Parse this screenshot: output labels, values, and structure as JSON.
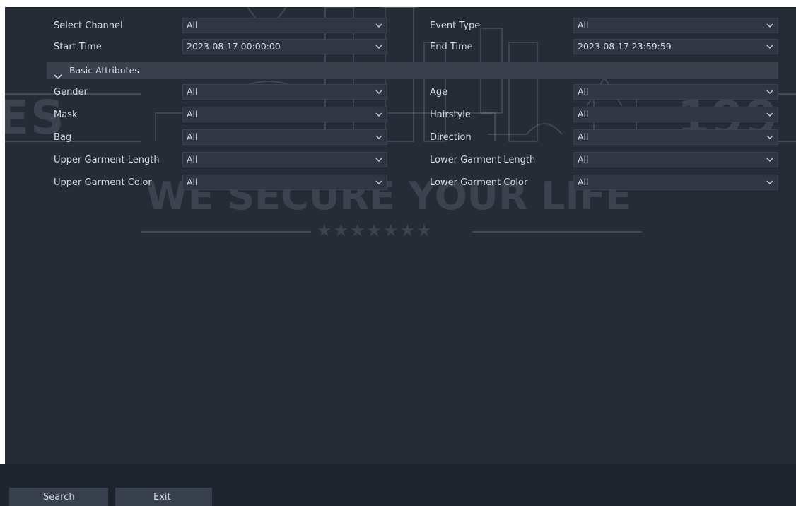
{
  "watermark": {
    "left_text": "ES",
    "right_text": "199",
    "slogan": "WE SECURE YOUR LIFE",
    "stars": "★★★★★★★"
  },
  "filters": {
    "select_channel": {
      "label": "Select Channel",
      "value": "All"
    },
    "event_type": {
      "label": "Event Type",
      "value": "All"
    },
    "start_time": {
      "label": "Start Time",
      "value": "2023-08-17 00:00:00"
    },
    "end_time": {
      "label": "End Time",
      "value": "2023-08-17 23:59:59"
    }
  },
  "section": {
    "label": "Basic Attributes"
  },
  "attributes": {
    "gender": {
      "label": "Gender",
      "value": "All"
    },
    "age": {
      "label": "Age",
      "value": "All"
    },
    "mask": {
      "label": "Mask",
      "value": "All"
    },
    "hairstyle": {
      "label": "Hairstyle",
      "value": "All"
    },
    "bag": {
      "label": "Bag",
      "value": "All"
    },
    "direction": {
      "label": "Direction",
      "value": "All"
    },
    "upper_garment_length": {
      "label": "Upper Garment Length",
      "value": "All"
    },
    "lower_garment_length": {
      "label": "Lower Garment Length",
      "value": "All"
    },
    "upper_garment_color": {
      "label": "Upper Garment Color",
      "value": "All"
    },
    "lower_garment_color": {
      "label": "Lower Garment Color",
      "value": "All"
    }
  },
  "footer": {
    "search_label": "Search",
    "exit_label": "Exit"
  },
  "colors": {
    "background": "#262b36",
    "field": "#303643",
    "section_bar": "#3a404c",
    "footer": "#1f232c",
    "text": "#d6d9e0"
  },
  "icons": {
    "dropdown": "chevron-down-icon",
    "section_toggle": "chevron-down-icon"
  }
}
